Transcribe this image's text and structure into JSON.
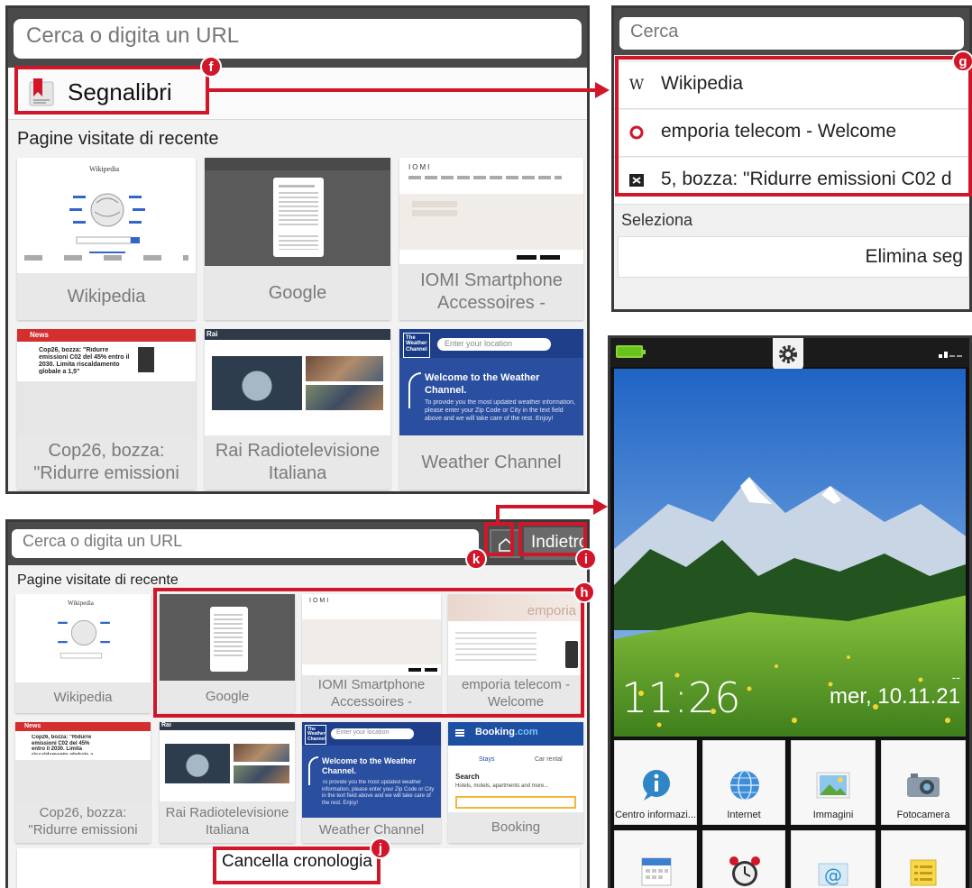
{
  "colors": {
    "accent_red": "#d2162a",
    "browser_dark": "#4a4a4a",
    "weather_blue": "#2a4fa0",
    "booking_blue": "#1d4fa3",
    "battery_green": "#67c31b"
  },
  "panel_a": {
    "url_placeholder": "Cerca o digita un URL",
    "bookmarks_label": "Segnalibri",
    "bookmarks_icon": "bookmark-icon",
    "recent_title": "Pagine visitate di recente",
    "marker": "f",
    "tiles": [
      {
        "caption": "Wikipedia"
      },
      {
        "caption": "Google"
      },
      {
        "caption": "IOMI Smartphone Accessoires -"
      },
      {
        "caption": "Cop26, bozza: \"Ridurre emissioni"
      },
      {
        "caption": "Rai Radiotelevisione Italiana"
      },
      {
        "caption": "Weather Channel"
      }
    ]
  },
  "thumbs": {
    "wikipedia_wordmark": "Wikipedia",
    "iomi_logo": "IOMI",
    "weather_logo": "The Weather Channel",
    "weather_location": "Enter your location",
    "weather_title": "Welcome to the Weather Channel.",
    "weather_body": "To provide you the most updated weather information, please enter your Zip Code or City in the text field above and we will take care of the rest. Enjoy!",
    "news_logo": "News",
    "news_headline": "Cop26, bozza: \"Ridurre emissioni C02 del 45% entro il 2030. Limita riscaldamento globale a 1,5\"",
    "rai_logo": "Rai",
    "emporia_logo": "emporia",
    "booking_logo_main": "Booking",
    "booking_logo_tld": ".com",
    "booking_stays": "Stays",
    "booking_car": "Car rental",
    "booking_search": "Search",
    "booking_hint": "Hotels, motels, apartments and more..."
  },
  "panel_b": {
    "search_placeholder": "Cerca",
    "marker": "g",
    "items": [
      {
        "icon": "wikipedia-w-icon",
        "glyph": "W",
        "label": "Wikipedia"
      },
      {
        "icon": "emporia-circle-icon",
        "glyph": "",
        "label": "emporia telecom - Welcome"
      },
      {
        "icon": "news-favicon",
        "glyph": "",
        "label": "5, bozza: \"Ridurre emissioni C02 d"
      }
    ],
    "select_label": "Seleziona",
    "delete_label": "Elimina seg"
  },
  "panel_c": {
    "time": "11:26",
    "date": "mer, 10.11.21",
    "date_dashes": "--",
    "apps": [
      {
        "label": "Centro informazi...",
        "icon": "info-icon"
      },
      {
        "label": "Internet",
        "icon": "globe-icon"
      },
      {
        "label": "Immagini",
        "icon": "pictures-icon"
      },
      {
        "label": "Fotocamera",
        "icon": "camera-icon"
      },
      {
        "label": "",
        "icon": "calendar-icon"
      },
      {
        "label": "",
        "icon": "alarm-clock-icon"
      },
      {
        "label": "",
        "icon": "email-icon"
      },
      {
        "label": "",
        "icon": "notes-icon"
      }
    ]
  },
  "panel_d": {
    "url_placeholder": "Cerca o digita un URL",
    "back_label": "Indietro",
    "recent_title": "Pagine visitate di recente",
    "markers": {
      "home": "k",
      "back": "i",
      "tiles": "h",
      "clear": "j"
    },
    "tiles": [
      {
        "caption": "Wikipedia"
      },
      {
        "caption": "Google"
      },
      {
        "caption": "IOMI Smartphone Accessoires -"
      },
      {
        "caption": "emporia telecom - Welcome"
      },
      {
        "caption": "Cop26, bozza: \"Ridurre emissioni"
      },
      {
        "caption": "Rai Radiotelevisione Italiana"
      },
      {
        "caption": "Weather Channel"
      },
      {
        "caption": "Booking"
      }
    ],
    "clear_label": "Cancella cronologia"
  }
}
